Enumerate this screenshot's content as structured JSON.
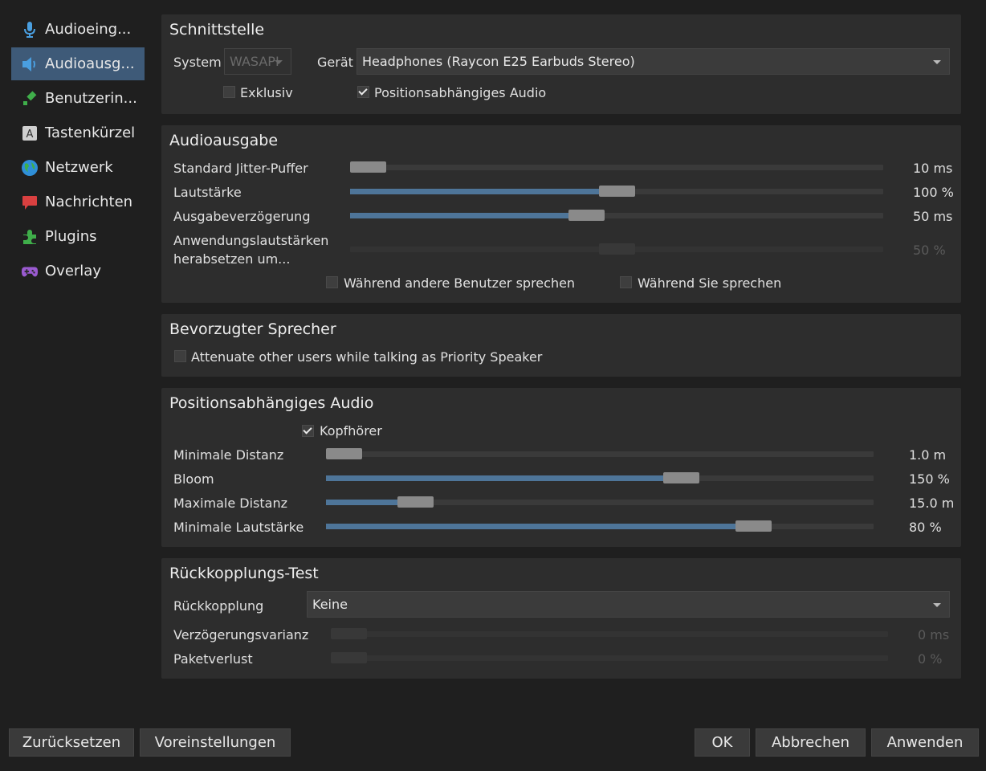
{
  "sidebar": {
    "items": [
      {
        "label": "Audioeing...",
        "icon": "microphone-icon"
      },
      {
        "label": "Audioausg...",
        "icon": "speaker-icon"
      },
      {
        "label": "Benutzerin...",
        "icon": "brush-icon"
      },
      {
        "label": "Tastenkürzel",
        "icon": "keyboard-key-icon"
      },
      {
        "label": "Netzwerk",
        "icon": "globe-icon"
      },
      {
        "label": "Nachrichten",
        "icon": "message-icon"
      },
      {
        "label": "Plugins",
        "icon": "puzzle-icon"
      },
      {
        "label": "Overlay",
        "icon": "gamepad-icon"
      }
    ],
    "active_index": 1
  },
  "interface": {
    "title": "Schnittstelle",
    "system_label": "System",
    "system_value": "WASAPI",
    "device_label": "Gerät",
    "device_value": "Headphones (Raycon E25 Earbuds Stereo)",
    "exclusive_label": "Exklusiv",
    "exclusive_checked": false,
    "positional_label": "Positionsabhängiges Audio",
    "positional_checked": true
  },
  "output": {
    "title": "Audioausgabe",
    "jitter_label": "Standard Jitter-Puffer",
    "jitter_value": "10 ms",
    "jitter_level": 0.0,
    "volume_label": "Lautstärke",
    "volume_value": "100 %",
    "volume_level": 0.5,
    "delay_label": "Ausgabeverzögerung",
    "delay_value": "50 ms",
    "delay_level": 0.44,
    "attenuate_label_1": "Anwendungslautstärken",
    "attenuate_label_2": "herabsetzen um...",
    "attenuate_value": "50 %",
    "attenuate_level": 0.5,
    "while_others_label": "Während andere Benutzer sprechen",
    "while_others_checked": false,
    "while_you_label": "Während Sie sprechen",
    "while_you_checked": false
  },
  "priority": {
    "title": "Bevorzugter Sprecher",
    "attenuate_label": "Attenuate other users while talking as Priority Speaker",
    "attenuate_checked": false
  },
  "positional": {
    "title": "Positionsabhängiges Audio",
    "headphones_label": "Kopfhörer",
    "headphones_checked": true,
    "min_dist_label": "Minimale Distanz",
    "min_dist_value": "1.0 m",
    "min_dist_level": 0.0,
    "bloom_label": "Bloom",
    "bloom_value": "150 %",
    "bloom_level": 0.66,
    "max_dist_label": "Maximale Distanz",
    "max_dist_value": "15.0 m",
    "max_dist_level": 0.14,
    "min_vol_label": "Minimale Lautstärke",
    "min_vol_value": "80 %",
    "min_vol_level": 0.8
  },
  "loopback": {
    "title": "Rückkopplungs-Test",
    "loopback_label": "Rückkopplung",
    "loopback_value": "Keine",
    "delay_var_label": "Verzögerungsvarianz",
    "delay_var_value": "0 ms",
    "delay_var_level": 0.0,
    "packet_loss_label": "Paketverlust",
    "packet_loss_value": "0 %",
    "packet_loss_level": 0.0
  },
  "buttons": {
    "reset": "Zurücksetzen",
    "defaults": "Voreinstellungen",
    "ok": "OK",
    "cancel": "Abbrechen",
    "apply": "Anwenden"
  },
  "colors": {
    "accent": "#4e7599",
    "selection": "#3e5a78",
    "panel": "#2d2d2d",
    "background": "#1f1f1f"
  }
}
